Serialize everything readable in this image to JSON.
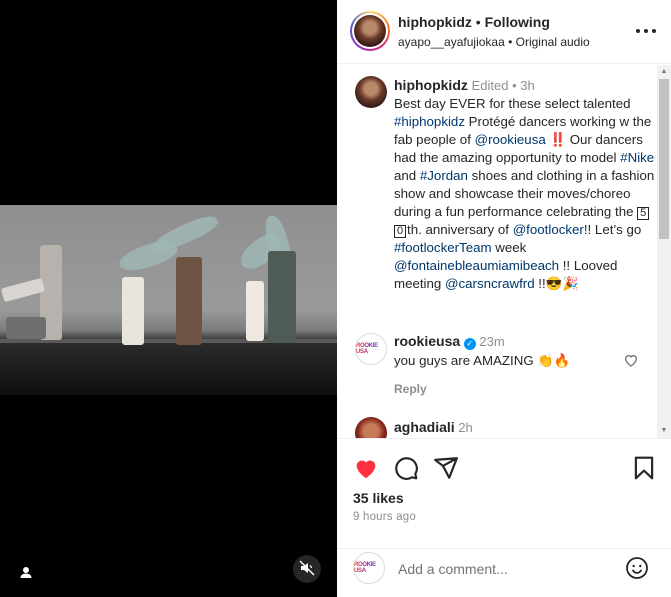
{
  "header": {
    "username": "hiphopkidz",
    "separator": " • ",
    "follow_state": "Following",
    "subtitle_user": "ayapo__ayafujiokaa",
    "subtitle_sep": " • ",
    "audio": "Original audio"
  },
  "caption": {
    "username": "hiphopkidz",
    "edited": "Edited",
    "dot": " • ",
    "time": "3h",
    "t1": "Best day EVER for these select talented ",
    "tag_hiphopkidz": "#hiphopkidz",
    "t2": " Protégé dancers working w the fab people of ",
    "mention_rookieusa": "@rookieusa",
    "t3": " ‼️ Our dancers had the amazing opportunity to model ",
    "tag_nike": "#Nike",
    "t4": " and ",
    "tag_jordan": "#Jordan",
    "t5": " shoes and clothing in a fashion show and showcase their moves/choreo during a fun performance celebrating the ",
    "box1": "5",
    "box2": "0",
    "t6": "th. anniversary of ",
    "mention_footlocker": "@footlocker",
    "t7": "!! Let’s go ",
    "tag_footlockerteam": "#footlockerTeam",
    "t8": " week ",
    "mention_fontainebleau": "@fontainebleaumiamibeach",
    "t9": " !! Looved meeting ",
    "mention_carsn": "@carsncrawfrd",
    "t10": " !!😎🎉"
  },
  "comments": [
    {
      "username": "rookieusa",
      "verified": "✓",
      "time": "23m",
      "text": "you guys are AMAZING 👏🔥",
      "reply_label": "Reply",
      "avatar_text": "ROOKIE USA"
    },
    {
      "username": "aghadiali",
      "time": "2h"
    }
  ],
  "engagement": {
    "likes": "35 likes",
    "posted": "9 hours ago"
  },
  "add_comment": {
    "placeholder": "Add a comment...",
    "avatar_text": "ROOKIE USA"
  },
  "colors": {
    "like_red": "#ff3040",
    "link_blue": "#00376b",
    "verified_blue": "#0095f6"
  },
  "icons": [
    "user-tag-icon",
    "mute-icon",
    "more-icon",
    "heart-filled-icon",
    "comment-icon",
    "share-icon",
    "bookmark-icon",
    "heart-outline-icon",
    "emoji-icon",
    "verified-icon"
  ]
}
